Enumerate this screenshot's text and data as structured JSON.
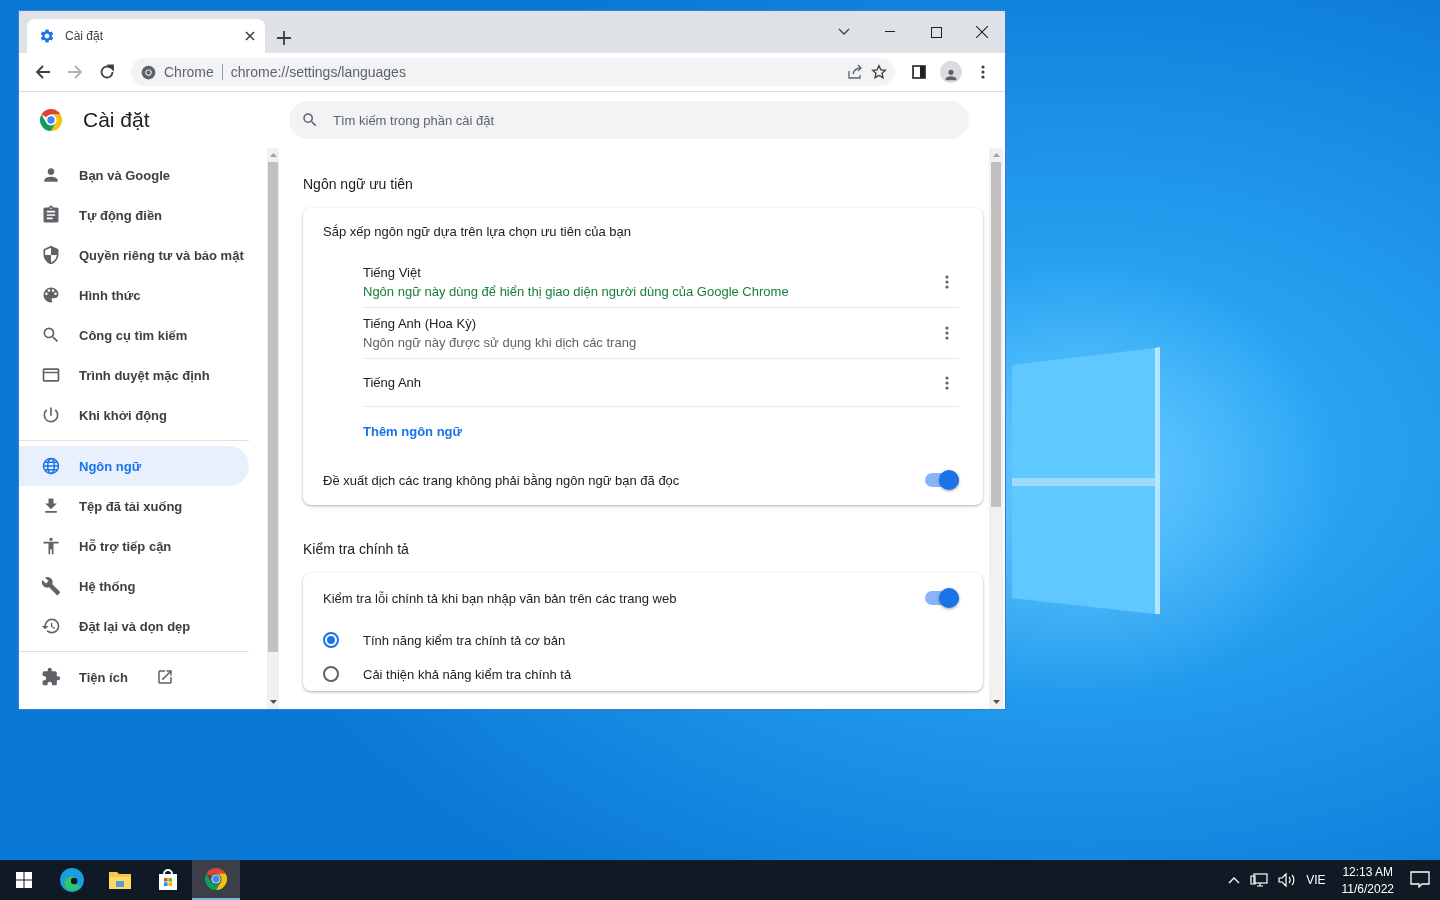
{
  "browser": {
    "tab": {
      "title": "Cài đặt",
      "selected": true
    },
    "omnibox": {
      "origin": "Chrome",
      "url": "chrome://settings/languages"
    }
  },
  "settings": {
    "title": "Cài đặt",
    "search_placeholder": "Tìm kiếm trong phần cài đặt",
    "nav_groups": [
      [
        {
          "label": "Bạn và Google",
          "selected": false
        },
        {
          "label": "Tự động điền",
          "selected": false
        },
        {
          "label": "Quyền riêng tư và bảo mật",
          "selected": false
        },
        {
          "label": "Hình thức",
          "selected": false
        },
        {
          "label": "Công cụ tìm kiếm",
          "selected": false
        },
        {
          "label": "Trình duyệt mặc định",
          "selected": false
        },
        {
          "label": "Khi khởi động",
          "selected": false
        }
      ],
      [
        {
          "label": "Ngôn ngữ",
          "selected": true
        },
        {
          "label": "Tệp đã tải xuống",
          "selected": false
        },
        {
          "label": "Hỗ trợ tiếp cận",
          "selected": false
        },
        {
          "label": "Hệ thống",
          "selected": false
        },
        {
          "label": "Đặt lại và dọn dẹp",
          "selected": false
        }
      ],
      [
        {
          "label": "Tiện ích",
          "selected": false,
          "external": true
        }
      ]
    ],
    "preferred": {
      "title": "Ngôn ngữ ưu tiên",
      "intro": "Sắp xếp ngôn ngữ dựa trên lựa chọn ưu tiên của bạn",
      "languages": [
        {
          "name": "Tiếng Việt",
          "note": "Ngôn ngữ này dùng để hiển thị giao diện người dùng của Google Chrome",
          "highlighted": true
        },
        {
          "name": "Tiếng Anh (Hoa Kỳ)",
          "note": "Ngôn ngữ này được sử dụng khi dịch các trang",
          "highlighted": false
        },
        {
          "name": "Tiếng Anh"
        }
      ],
      "add_link": "Thêm ngôn ngữ",
      "offer_translate": {
        "label": "Đề xuất dịch các trang không phải bằng ngôn ngữ bạn đã đọc",
        "on": true
      }
    },
    "spellcheck": {
      "title": "Kiểm tra chính tả",
      "toggle": {
        "label": "Kiểm tra lỗi chính tả khi bạn nhập văn bản trên các trang web",
        "on": true
      },
      "options": [
        {
          "label": "Tính năng kiểm tra chính tả cơ bản",
          "selected": true
        },
        {
          "label": "Cải thiện khả năng kiểm tra chính tả",
          "selected": false
        }
      ]
    }
  },
  "taskbar": {
    "apps": [
      {
        "selected": false
      },
      {
        "selected": false
      },
      {
        "selected": false
      },
      {
        "selected": true
      }
    ],
    "language": "VIE",
    "time": "12:13 AM",
    "date": "11/6/2022"
  }
}
